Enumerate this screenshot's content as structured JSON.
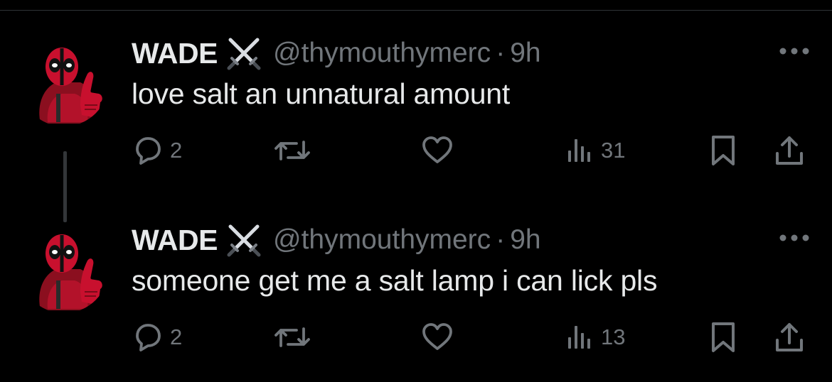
{
  "tweets": [
    {
      "author_name": "WADE",
      "handle": "@thymouthymerc",
      "separator": "·",
      "time": "9h",
      "text": "love salt an unnatural amount",
      "replies": "2",
      "views": "31"
    },
    {
      "author_name": "WADE",
      "handle": "@thymouthymerc",
      "separator": "·",
      "time": "9h",
      "text": "someone get me a salt lamp i can lick pls",
      "replies": "2",
      "views": "13"
    }
  ],
  "icons": {
    "badge": "crossed-swords-icon",
    "more": "more-options-icon",
    "reply": "reply-icon",
    "retweet": "retweet-icon",
    "like": "heart-icon",
    "views": "views-icon",
    "bookmark": "bookmark-icon",
    "share": "share-icon"
  },
  "colors": {
    "background": "#000000",
    "text_primary": "#e7e9ea",
    "text_secondary": "#71767b",
    "divider": "#2f3336",
    "avatar_red": "#c8102e"
  }
}
